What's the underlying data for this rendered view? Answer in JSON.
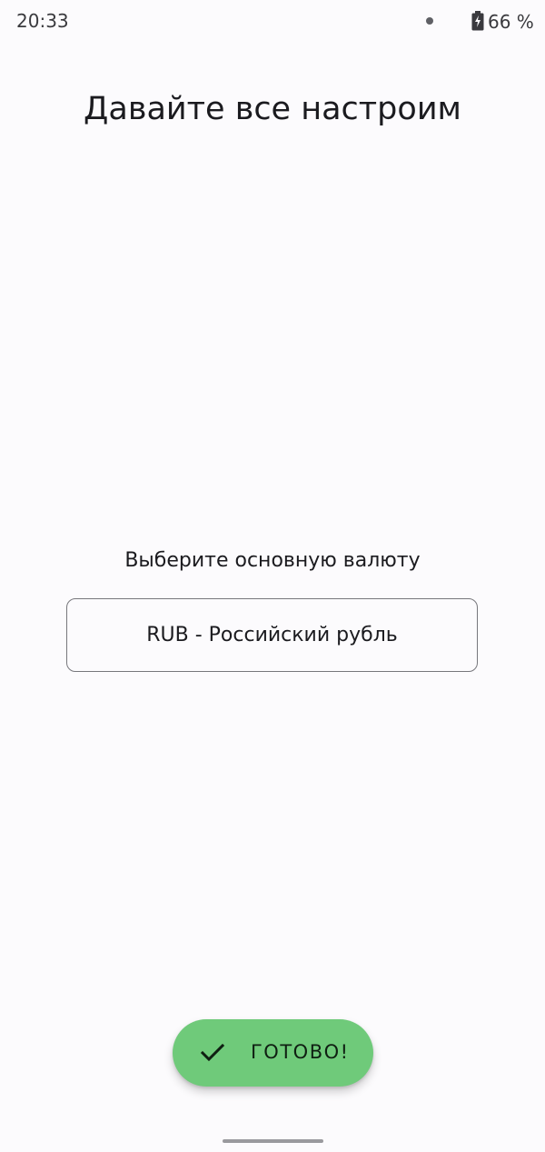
{
  "status_bar": {
    "time": "20:33",
    "battery": "66 %"
  },
  "page": {
    "title": "Давайте все настроим"
  },
  "currency": {
    "label": "Выберите основную валюту",
    "selected": "RUB - Российский рубль"
  },
  "done_button": {
    "label": "ГОТОВО!",
    "icon": "check-icon",
    "color": "#6fca7a"
  }
}
